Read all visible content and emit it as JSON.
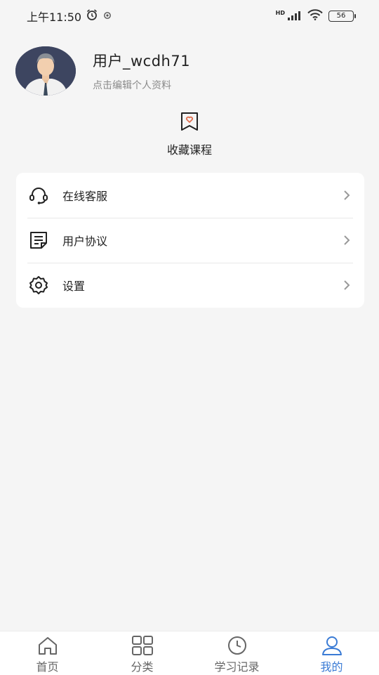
{
  "status_bar": {
    "time": "上午11:50",
    "network_label": "HD",
    "battery": "56"
  },
  "profile": {
    "username": "用户_wcdh71",
    "edit_hint": "点击编辑个人资料"
  },
  "favorites": {
    "label": "收藏课程"
  },
  "menu": {
    "items": [
      {
        "label": "在线客服",
        "icon": "headset-icon"
      },
      {
        "label": "用户协议",
        "icon": "document-icon"
      },
      {
        "label": "设置",
        "icon": "gear-icon"
      }
    ]
  },
  "tab_bar": {
    "tabs": [
      {
        "label": "首页",
        "icon": "home-icon"
      },
      {
        "label": "分类",
        "icon": "grid-icon"
      },
      {
        "label": "学习记录",
        "icon": "clock-icon"
      },
      {
        "label": "我的",
        "icon": "person-icon"
      }
    ],
    "active_color": "#3a7bd5",
    "inactive_color": "#666666"
  }
}
